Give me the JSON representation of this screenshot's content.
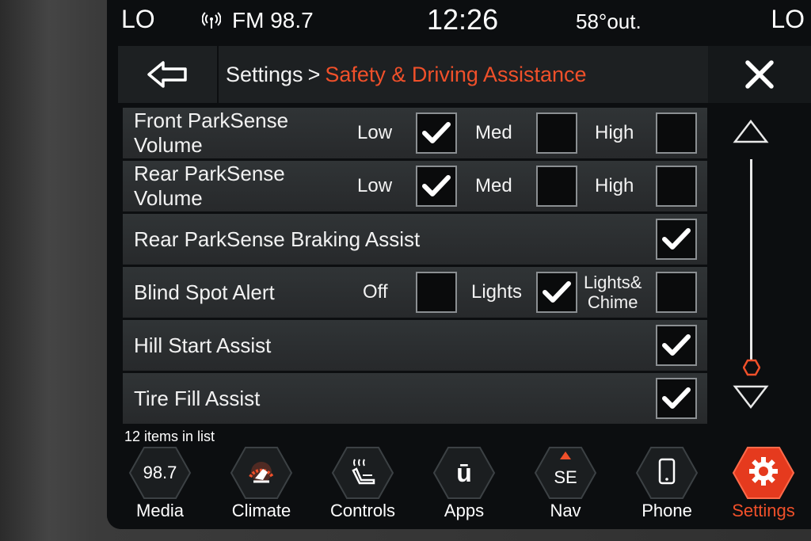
{
  "status": {
    "climate_left": "LO",
    "radio": "FM 98.7",
    "time": "12:26",
    "outside_temp": "58°out.",
    "climate_right": "LO"
  },
  "header": {
    "breadcrumb_root": "Settings",
    "breadcrumb_sep": ">",
    "breadcrumb_current": "Safety & Driving Assistance"
  },
  "settings": {
    "front_parksense": {
      "label_line1": "Front ParkSense",
      "label_line2": "Volume",
      "options": [
        {
          "label": "Low",
          "checked": true
        },
        {
          "label": "Med",
          "checked": false
        },
        {
          "label": "High",
          "checked": false
        }
      ]
    },
    "rear_parksense": {
      "label_line1": "Rear ParkSense",
      "label_line2": "Volume",
      "options": [
        {
          "label": "Low",
          "checked": true
        },
        {
          "label": "Med",
          "checked": false
        },
        {
          "label": "High",
          "checked": false
        }
      ]
    },
    "rear_braking": {
      "label": "Rear ParkSense Braking Assist",
      "checked": true
    },
    "blind_spot": {
      "label": "Blind Spot Alert",
      "options": [
        {
          "label": "Off",
          "checked": false
        },
        {
          "label": "Lights",
          "checked": true
        },
        {
          "label_line1": "Lights&",
          "label_line2": "Chime",
          "checked": false
        }
      ]
    },
    "hill_start": {
      "label": "Hill Start Assist",
      "checked": true
    },
    "tire_fill": {
      "label": "Tire Fill Assist",
      "checked": true
    }
  },
  "list_count": "12 items in list",
  "scroll_position": 0.95,
  "nav": {
    "media": {
      "label": "Media",
      "icon_text": "98.7"
    },
    "climate": {
      "label": "Climate",
      "icon": "climate-seat-icon"
    },
    "controls": {
      "label": "Controls",
      "icon": "heated-seat-icon"
    },
    "apps": {
      "label": "Apps",
      "icon_text": "ū"
    },
    "nav": {
      "label": "Nav",
      "icon_text": "SE"
    },
    "phone": {
      "label": "Phone",
      "icon": "phone-icon"
    },
    "settings": {
      "label": "Settings",
      "icon": "gear-icon"
    }
  },
  "colors": {
    "accent": "#f0502a",
    "row_bg": "#2c2f31",
    "screen_bg": "#0c0e10"
  }
}
